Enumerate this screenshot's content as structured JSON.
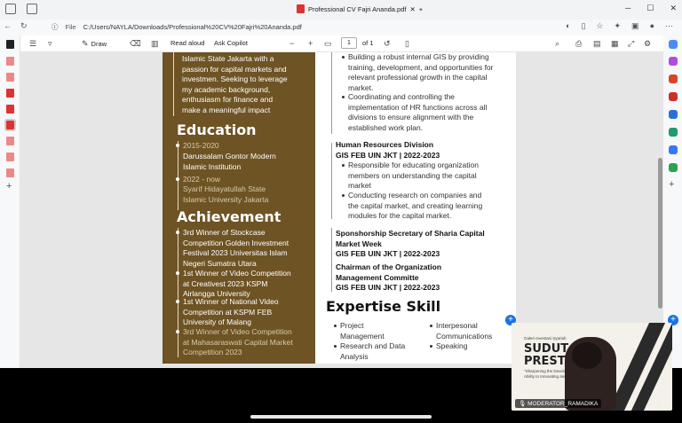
{
  "window": {
    "title": "Professional CV Fajri Ananda.pdf"
  },
  "addressbar": {
    "scheme_label": "File",
    "url": "C:/Users/NAYLA/Downloads/Professional%20CV%20Fajri%20Ananda.pdf"
  },
  "pdf_toolbar": {
    "draw_label": "Draw",
    "read_aloud_label": "Read aloud",
    "ask_copilot_label": "Ask Copilot",
    "zoom_out": "−",
    "zoom_in": "+",
    "current_page": "1",
    "page_total": "of 1"
  },
  "cv": {
    "about_lines": [
      "Islamic State Jakarta with a",
      "passion for capital markets and",
      "investmen. Seeking to leverage",
      "my academic background,",
      "enthusiasm for finance and",
      "make a meaningful impact"
    ],
    "education": {
      "heading": "Education",
      "entries": [
        {
          "years": "2015-2020",
          "lines": [
            "Darussalam Gontor Modern",
            "Islamic Institution"
          ]
        },
        {
          "years": "2022 - now",
          "lines": [
            "Syarif Hidayatullah State",
            "Islamic University Jakarta"
          ]
        }
      ]
    },
    "achievement": {
      "heading": "Achievement",
      "entries": [
        {
          "lines": [
            "3rd Winner of Stockcase",
            "Competition Golden Investment",
            "Festival 2023 Universitas Islam",
            "Negeri Sumatra Utara"
          ]
        },
        {
          "lines": [
            "1st Winner of Video Competition",
            "at Creativest 2023 KSPM",
            "Airlangga University"
          ]
        },
        {
          "lines": [
            "1st Winner of National Video",
            "Competition at  KSPM FEB",
            "University of Malang"
          ]
        },
        {
          "lines": [
            "3rd Winner of Video Competition",
            "at Mahasaraswati Capital Market",
            "Competition 2023"
          ]
        }
      ]
    },
    "experience_top_bullets": [
      [
        "Building a robust internal GIS by providing",
        "training, development, and opportunities for",
        "relevant professional growth in the capital",
        "market."
      ],
      [
        "Coordinating and controlling the",
        "implementation of HR functions across all",
        "divisions to ensure alignment with the",
        "established work plan."
      ]
    ],
    "hr_division": {
      "title": "Human Resources Division",
      "org": "GIS FEB UIN JKT | 2022-2023",
      "bullets": [
        [
          "Responsible for educating organization",
          "members on understanding the capital",
          "market"
        ],
        [
          "Conducting research on companies and",
          "the capital market, and creating learning",
          "modules for the capital market."
        ]
      ]
    },
    "sponsorship": {
      "title_lines": [
        "Sponshorship Secretary of Sharia Capital",
        "Market Week"
      ],
      "org": "GIS FEB UIN JKT | 2022-2023"
    },
    "chairman": {
      "title_lines": [
        "Chairman of the Organization",
        "Management Committe"
      ],
      "org": "GIS FEB UIN JKT | 2022-2023"
    },
    "skills": {
      "heading": "Expertise Skill",
      "left": [
        [
          "Project",
          "Management"
        ],
        [
          "Research and Data",
          "Analysis"
        ]
      ],
      "right": [
        [
          "Interpesonal",
          "Communications"
        ],
        [
          "Speaking"
        ]
      ]
    }
  },
  "video_call": {
    "participant": "MODERATOR_RAMADIKA",
    "slide_big_1": "SUDUT",
    "slide_big_2": "PRESTA",
    "slide_small_1": "Galeri Investasi Syariah",
    "slide_small_2": "\"Sharpening the Development",
    "slide_small_3": "Ability to Innovating and Com"
  }
}
